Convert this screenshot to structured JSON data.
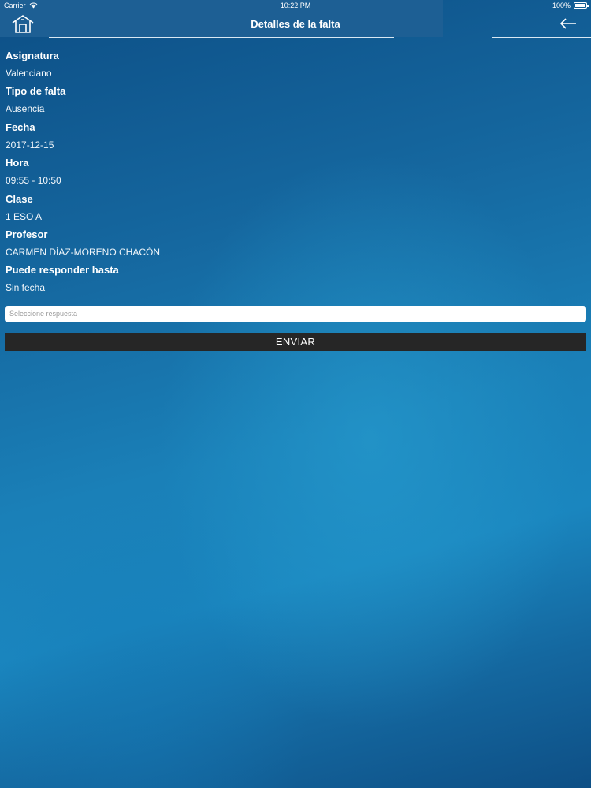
{
  "status_bar": {
    "carrier": "Carrier",
    "time": "10:22 PM",
    "battery": "100%"
  },
  "nav": {
    "title": "Detalles de la falta",
    "home_icon": "home-icon",
    "back_icon": "arrow-left-icon"
  },
  "details": [
    {
      "label": "Asignatura",
      "value": "Valenciano"
    },
    {
      "label": "Tipo de falta",
      "value": "Ausencia"
    },
    {
      "label": "Fecha",
      "value": "2017-12-15"
    },
    {
      "label": "Hora",
      "value": "09:55 - 10:50"
    },
    {
      "label": "Clase",
      "value": "1 ESO A"
    },
    {
      "label": "Profesor",
      "value": "CARMEN DÍAZ-MORENO CHACÓN"
    },
    {
      "label": "Puede responder hasta",
      "value": "Sin fecha"
    }
  ],
  "response": {
    "placeholder": "Seleccione respuesta"
  },
  "actions": {
    "send_label": "ENVIAR"
  },
  "colors": {
    "background_top": "#0d4f86",
    "background_mid": "#1a86bf",
    "button_bg": "#262626",
    "text": "#ffffff"
  }
}
